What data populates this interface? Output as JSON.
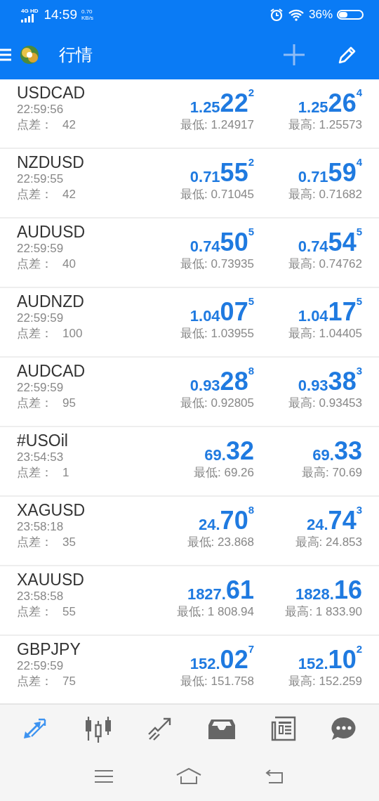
{
  "status_bar": {
    "network": "4G HD",
    "time": "14:59",
    "speed": "0.70",
    "speed_unit": "KB/s",
    "battery": "36%"
  },
  "toolbar": {
    "title": "行情"
  },
  "quotes": [
    {
      "symbol": "USDCAD",
      "time": "22:59:56",
      "spread_label": "点差：",
      "spread": "42",
      "bid": {
        "small": "1.25",
        "big": "22",
        "sup": "2"
      },
      "ask": {
        "small": "1.25",
        "big": "26",
        "sup": "4"
      },
      "low": "最低: 1.24917",
      "high": "最高: 1.25573"
    },
    {
      "symbol": "NZDUSD",
      "time": "22:59:55",
      "spread_label": "点差：",
      "spread": "42",
      "bid": {
        "small": "0.71",
        "big": "55",
        "sup": "2"
      },
      "ask": {
        "small": "0.71",
        "big": "59",
        "sup": "4"
      },
      "low": "最低: 0.71045",
      "high": "最高: 0.71682"
    },
    {
      "symbol": "AUDUSD",
      "time": "22:59:59",
      "spread_label": "点差：",
      "spread": "40",
      "bid": {
        "small": "0.74",
        "big": "50",
        "sup": "5"
      },
      "ask": {
        "small": "0.74",
        "big": "54",
        "sup": "5"
      },
      "low": "最低: 0.73935",
      "high": "最高: 0.74762"
    },
    {
      "symbol": "AUDNZD",
      "time": "22:59:59",
      "spread_label": "点差：",
      "spread": "100",
      "bid": {
        "small": "1.04",
        "big": "07",
        "sup": "5"
      },
      "ask": {
        "small": "1.04",
        "big": "17",
        "sup": "5"
      },
      "low": "最低: 1.03955",
      "high": "最高: 1.04405"
    },
    {
      "symbol": "AUDCAD",
      "time": "22:59:59",
      "spread_label": "点差：",
      "spread": "95",
      "bid": {
        "small": "0.93",
        "big": "28",
        "sup": "8"
      },
      "ask": {
        "small": "0.93",
        "big": "38",
        "sup": "3"
      },
      "low": "最低: 0.92805",
      "high": "最高: 0.93453"
    },
    {
      "symbol": "#USOil",
      "time": "23:54:53",
      "spread_label": "点差：",
      "spread": "1",
      "bid": {
        "small": "69.",
        "big": "32"
      },
      "ask": {
        "small": "69.",
        "big": "33"
      },
      "low": "最低: 69.26",
      "high": "最高: 70.69"
    },
    {
      "symbol": "XAGUSD",
      "time": "23:58:18",
      "spread_label": "点差：",
      "spread": "35",
      "bid": {
        "small": "24.",
        "big": "70",
        "sup": "8"
      },
      "ask": {
        "small": "24.",
        "big": "74",
        "sup": "3"
      },
      "low": "最低: 23.868",
      "high": "最高: 24.853"
    },
    {
      "symbol": "XAUUSD",
      "time": "23:58:58",
      "spread_label": "点差：",
      "spread": "55",
      "bid": {
        "small": "1827.",
        "big": "61"
      },
      "ask": {
        "small": "1828.",
        "big": "16"
      },
      "low": "最低: 1 808.94",
      "high": "最高: 1 833.90"
    },
    {
      "symbol": "GBPJPY",
      "time": "22:59:59",
      "spread_label": "点差：",
      "spread": "75",
      "bid": {
        "small": "152.",
        "big": "02",
        "sup": "7"
      },
      "ask": {
        "small": "152.",
        "big": "10",
        "sup": "2"
      },
      "low": "最低: 151.758",
      "high": "最高: 152.259"
    }
  ],
  "bottom_tabs": [
    {
      "kind": "quotes",
      "selected": true
    },
    {
      "kind": "chart",
      "selected": false
    },
    {
      "kind": "trade",
      "selected": false
    },
    {
      "kind": "history",
      "selected": false
    },
    {
      "kind": "news",
      "selected": false
    },
    {
      "kind": "chat",
      "selected": false
    }
  ]
}
